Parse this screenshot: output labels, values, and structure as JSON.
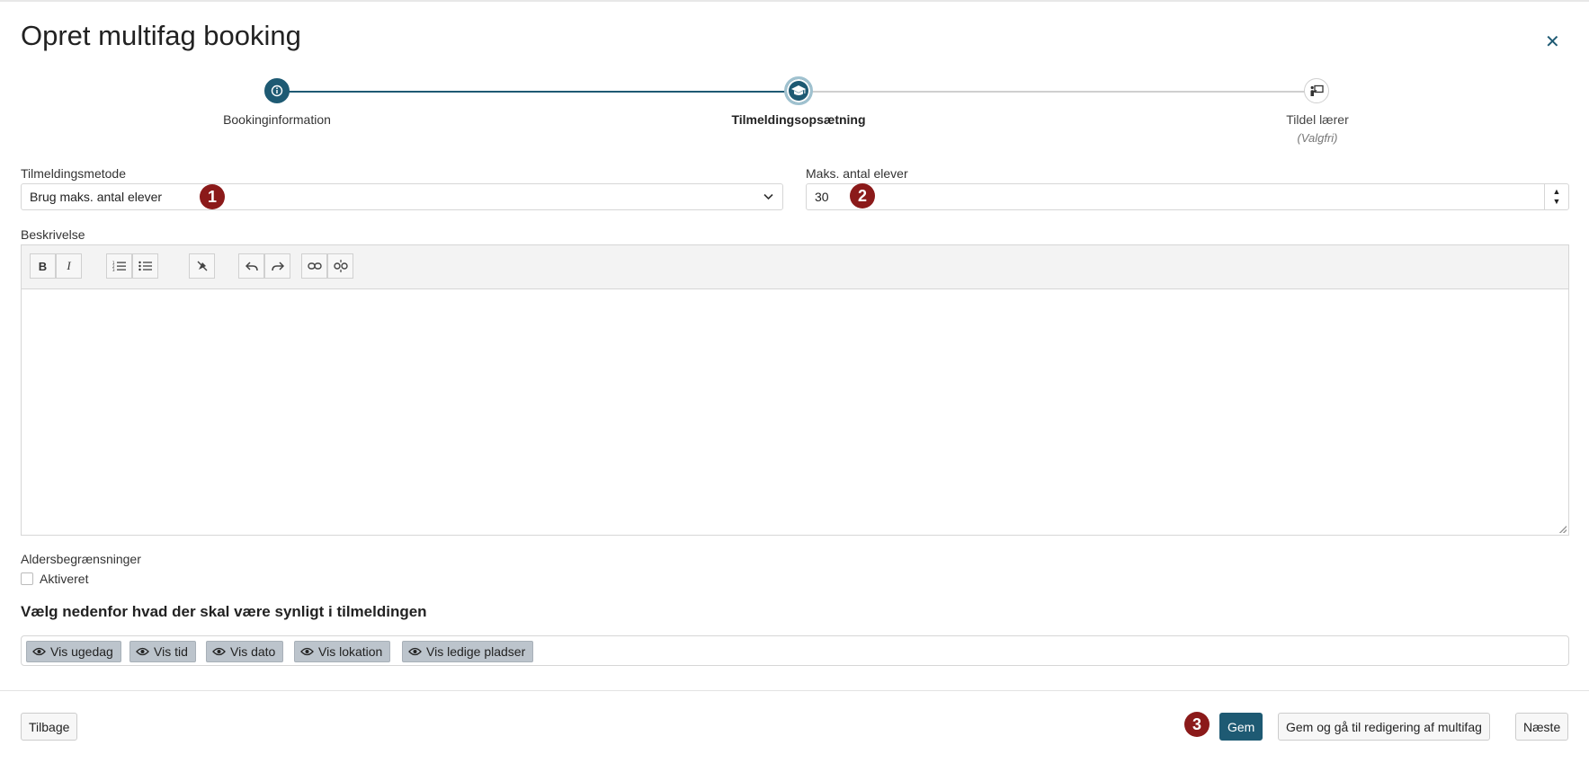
{
  "dialog": {
    "title": "Opret multifag booking"
  },
  "stepper": {
    "steps": [
      {
        "label": "Bookinginformation",
        "state": "done"
      },
      {
        "label": "Tilmeldingsopsætning",
        "state": "active"
      },
      {
        "label": "Tildel lærer",
        "sublabel": "(Valgfri)",
        "state": "pending"
      }
    ]
  },
  "form": {
    "method_label": "Tilmeldingsmetode",
    "method_value": "Brug maks. antal elever",
    "max_label": "Maks. antal elever",
    "max_value": "30",
    "description_label": "Beskrivelse",
    "age_label": "Aldersbegrænsninger",
    "age_checkbox_label": "Aktiveret",
    "visibility_heading": "Vælg nedenfor hvad der skal være synligt i tilmeldingen",
    "visibility_tags": [
      "Vis ugedag",
      "Vis tid",
      "Vis dato",
      "Vis lokation",
      "Vis ledige pladser"
    ]
  },
  "badges": [
    "1",
    "2",
    "3"
  ],
  "footer": {
    "back_label": "Tilbage",
    "save_label": "Gem",
    "save_edit_label": "Gem og gå til redigering af multifag",
    "next_label": "Næste"
  },
  "colors": {
    "accent": "#1e5a73",
    "badge": "#8b1a1a",
    "tag_bg": "#bcc4cc"
  }
}
